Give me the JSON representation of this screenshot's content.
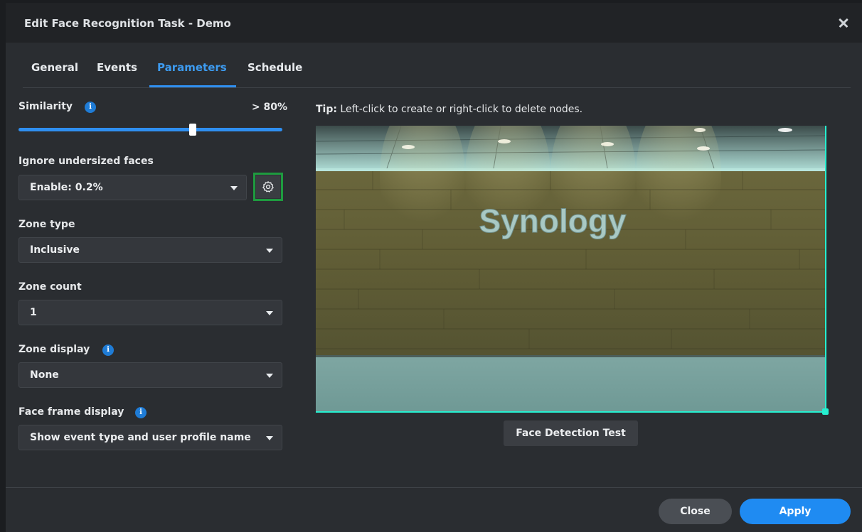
{
  "window": {
    "title": "Edit Face Recognition Task - Demo"
  },
  "tabs": [
    {
      "label": "General"
    },
    {
      "label": "Events"
    },
    {
      "label": "Parameters",
      "active": true
    },
    {
      "label": "Schedule"
    }
  ],
  "similarity": {
    "label": "Similarity",
    "value_text": "> 80%",
    "value_fraction": 0.66
  },
  "undersized": {
    "label": "Ignore undersized faces",
    "selected": "Enable: 0.2%"
  },
  "zone_type": {
    "label": "Zone type",
    "selected": "Inclusive"
  },
  "zone_count": {
    "label": "Zone count",
    "selected": "1"
  },
  "zone_display": {
    "label": "Zone display",
    "selected": "None"
  },
  "face_frame": {
    "label": "Face frame display",
    "selected": "Show event type and user profile name"
  },
  "tip": {
    "prefix": "Tip:",
    "text": " Left-click to create or right-click to delete nodes."
  },
  "preview": {
    "sign_text": "Synology"
  },
  "buttons": {
    "face_detection_test": "Face Detection Test",
    "close": "Close",
    "apply": "Apply"
  },
  "colors": {
    "accent": "#2f8ff0",
    "highlight_border": "#1e9b3f",
    "zone": "#25f0d0"
  }
}
